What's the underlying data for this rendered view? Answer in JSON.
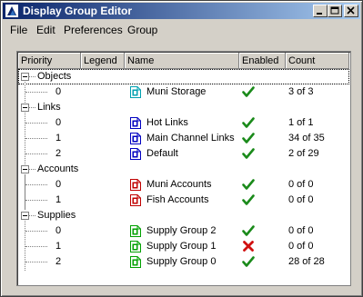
{
  "window": {
    "title": "Display Group Editor",
    "buttons": [
      "minimize",
      "maximize",
      "close"
    ]
  },
  "menubar": {
    "items": [
      "File",
      "Edit",
      "Preferences",
      "Group"
    ]
  },
  "columns": [
    "Priority",
    "Legend",
    "Name",
    "Enabled",
    "Count"
  ],
  "groups": [
    {
      "label": "Objects",
      "rows": [
        {
          "priority": "0",
          "name": "Muni Storage",
          "icon": "storage-icon",
          "color": "#00a0b0",
          "enabled": true,
          "count": "3 of 3"
        }
      ]
    },
    {
      "label": "Links",
      "rows": [
        {
          "priority": "0",
          "name": "Hot Links",
          "icon": "link-icon",
          "color": "#0000c0",
          "enabled": true,
          "count": "1 of 1"
        },
        {
          "priority": "1",
          "name": "Main Channel Links",
          "icon": "link-icon",
          "color": "#0000c0",
          "enabled": true,
          "count": "34 of 35"
        },
        {
          "priority": "2",
          "name": "Default",
          "icon": "link-icon",
          "color": "#0000c0",
          "enabled": true,
          "count": "2 of 29"
        }
      ]
    },
    {
      "label": "Accounts",
      "rows": [
        {
          "priority": "0",
          "name": "Muni Accounts",
          "icon": "account-icon",
          "color": "#c00000",
          "enabled": true,
          "count": "0 of 0"
        },
        {
          "priority": "1",
          "name": "Fish Accounts",
          "icon": "account-icon",
          "color": "#c00000",
          "enabled": true,
          "count": "0 of 0"
        }
      ]
    },
    {
      "label": "Supplies",
      "rows": [
        {
          "priority": "0",
          "name": "Supply Group 2",
          "icon": "supply-icon",
          "color": "#00a000",
          "enabled": true,
          "count": "0 of 0"
        },
        {
          "priority": "1",
          "name": "Supply Group 1",
          "icon": "supply-icon",
          "color": "#00a000",
          "enabled": false,
          "count": "0 of 0"
        },
        {
          "priority": "2",
          "name": "Supply Group 0",
          "icon": "supply-icon",
          "color": "#00a000",
          "enabled": true,
          "count": "28 of 28"
        }
      ]
    }
  ],
  "colors": {
    "check": "#1a8a1a",
    "cross": "#d01010",
    "titlebar_start": "#0a246a",
    "titlebar_end": "#a6caf0"
  }
}
